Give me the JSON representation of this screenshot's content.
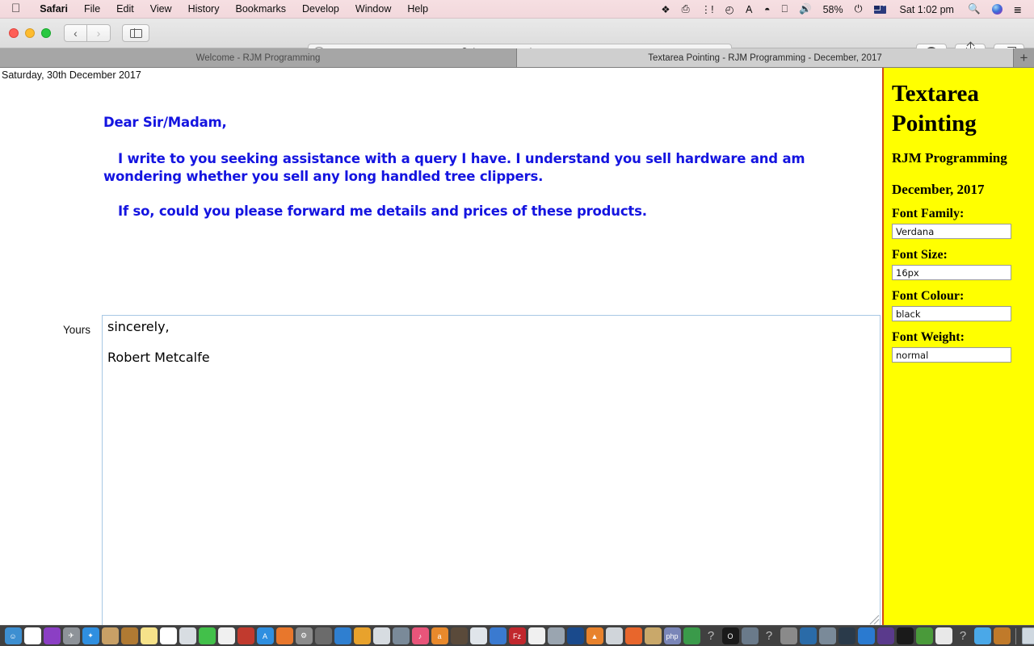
{
  "menubar": {
    "apple_icon": "apple-logo-icon",
    "items": [
      {
        "label": "Safari",
        "bold": true
      },
      {
        "label": "File",
        "bold": false
      },
      {
        "label": "Edit",
        "bold": false
      },
      {
        "label": "View",
        "bold": false
      },
      {
        "label": "History",
        "bold": false
      },
      {
        "label": "Bookmarks",
        "bold": false
      },
      {
        "label": "Develop",
        "bold": false
      },
      {
        "label": "Window",
        "bold": false
      },
      {
        "label": "Help",
        "bold": false
      }
    ],
    "status": {
      "battery_percent": "58%",
      "clock": "Sat 1:02 pm",
      "icons": [
        "dropbox-icon",
        "airplay-audio-icon",
        "wifi-signal-dots-icon",
        "time-machine-icon",
        "bluetooth-icon",
        "wifi-icon",
        "screen-mirroring-icon",
        "volume-icon",
        "battery-charging-icon",
        "australia-flag-icon",
        "spotlight-search-icon",
        "siri-icon",
        "notification-center-icon"
      ]
    }
  },
  "toolbar": {
    "back_label": "‹",
    "forward_label": "›",
    "url": "rjmprogramming.com.au",
    "reload_label": "↻",
    "plus_label": "+",
    "buttons": [
      "downloads-button",
      "share-button",
      "tab-overview-button"
    ]
  },
  "tabs": {
    "inactive_label": "Welcome - RJM Programming",
    "active_label": "Textarea Pointing - RJM Programming - December, 2017",
    "new_tab_label": "+"
  },
  "page": {
    "datestamp": "Saturday, 30th December 2017",
    "greeting": "Dear Sir/Madam,",
    "paragraph1": "I write to you seeking assistance with a query I have.  I understand you sell hardware and am wondering whether you sell any long handled tree clippers.",
    "paragraph2": "If so, could you please forward me details and prices of these products.",
    "letter_colour": "#1414e0",
    "yours_label": "Yours",
    "textarea_value": "sincerely,\n\nRobert Metcalfe"
  },
  "sidebar": {
    "title_line1": "Textarea",
    "title_line2": "Pointing",
    "subtitle": "RJM Programming",
    "date": "December, 2017",
    "background_colour": "#ffff00",
    "fields": [
      {
        "label": "Font Family:",
        "value": "Verdana",
        "name": "font-family-input"
      },
      {
        "label": "Font Size:",
        "value": "16px",
        "name": "font-size-input"
      },
      {
        "label": "Font Colour:",
        "value": "black",
        "name": "font-colour-input"
      },
      {
        "label": "Font Weight:",
        "value": "normal",
        "name": "font-weight-input"
      }
    ]
  },
  "dock": {
    "icons": [
      {
        "name": "finder-icon",
        "colour": "#3d8fd1",
        "glyph": "☺",
        "running": true
      },
      {
        "name": "document-icon",
        "colour": "#ffffff",
        "glyph": "",
        "running": true
      },
      {
        "name": "siri-icon",
        "colour": "#8b3fc4",
        "glyph": "",
        "running": false
      },
      {
        "name": "launchpad-icon",
        "colour": "#8e9399",
        "glyph": "✈",
        "running": false
      },
      {
        "name": "safari-icon",
        "colour": "#2f8fe0",
        "glyph": "✦",
        "running": true
      },
      {
        "name": "contacts-icon",
        "colour": "#c8a066",
        "glyph": "",
        "running": false
      },
      {
        "name": "notes-book-icon",
        "colour": "#b07a33",
        "glyph": "",
        "running": false
      },
      {
        "name": "notes-icon",
        "colour": "#f6e28a",
        "glyph": "",
        "running": false
      },
      {
        "name": "calendar-icon",
        "colour": "#ffffff",
        "glyph": "30",
        "running": false
      },
      {
        "name": "preview-icon",
        "colour": "#d8dde2",
        "glyph": "",
        "running": false
      },
      {
        "name": "messages-icon",
        "colour": "#42c04a",
        "glyph": "",
        "running": false
      },
      {
        "name": "photos-icon",
        "colour": "#f0f0f0",
        "glyph": "",
        "running": false
      },
      {
        "name": "qr-app-icon",
        "colour": "#c13a2e",
        "glyph": "",
        "running": false
      },
      {
        "name": "app-store-icon",
        "colour": "#2f8fe0",
        "glyph": "A",
        "running": false
      },
      {
        "name": "ibooks-icon",
        "colour": "#e8772c",
        "glyph": "",
        "running": false
      },
      {
        "name": "system-preferences-icon",
        "colour": "#8c8c8c",
        "glyph": "⚙",
        "running": true
      },
      {
        "name": "airport-utility-icon",
        "colour": "#6b6b6b",
        "glyph": "",
        "running": false
      },
      {
        "name": "bin-blue-icon",
        "colour": "#2f7fd0",
        "glyph": "",
        "running": false
      },
      {
        "name": "wolfram-icon",
        "colour": "#e8a22c",
        "glyph": "",
        "running": true
      },
      {
        "name": "pen-app-icon",
        "colour": "#d7dce1",
        "glyph": "",
        "running": true
      },
      {
        "name": "image-capture-icon",
        "colour": "#7a8a99",
        "glyph": "",
        "running": true
      },
      {
        "name": "itunes-icon",
        "colour": "#e8557a",
        "glyph": "♪",
        "running": false
      },
      {
        "name": "amazon-icon",
        "colour": "#e8892c",
        "glyph": "a",
        "running": false
      },
      {
        "name": "gimp-icon",
        "colour": "#5a4a3a",
        "glyph": "",
        "running": false
      },
      {
        "name": "maps-icon",
        "colour": "#e0e5ea",
        "glyph": "",
        "running": false
      },
      {
        "name": "remote-desktop-icon",
        "colour": "#3a7ad0",
        "glyph": "",
        "running": false
      },
      {
        "name": "filezilla-icon",
        "colour": "#c1272d",
        "glyph": "Fz",
        "running": false
      },
      {
        "name": "chrome-icon",
        "colour": "#f0f0f0",
        "glyph": "",
        "running": false
      },
      {
        "name": "ie-icon",
        "colour": "#9aa5b0",
        "glyph": "",
        "running": false
      },
      {
        "name": "opera-blue-icon",
        "colour": "#1a4a8c",
        "glyph": "",
        "running": false
      },
      {
        "name": "vlc-icon",
        "colour": "#e8822c",
        "glyph": "▲",
        "running": false
      },
      {
        "name": "cube-icon",
        "colour": "#d0d5da",
        "glyph": "",
        "running": false
      },
      {
        "name": "firefox-icon",
        "colour": "#e8662c",
        "glyph": "",
        "running": true
      },
      {
        "name": "text-app-icon",
        "colour": "#c9a86a",
        "glyph": "",
        "running": false
      },
      {
        "name": "php-icon",
        "colour": "#7a86b8",
        "glyph": "php",
        "running": true
      },
      {
        "name": "android-studio-icon",
        "colour": "#3a9a4a",
        "glyph": "",
        "running": false
      },
      {
        "name": "unknown-app-1-icon",
        "colour": "transparent",
        "glyph": "?",
        "running": false
      },
      {
        "name": "opera-icon",
        "colour": "#1a1a1a",
        "glyph": "O",
        "running": true
      },
      {
        "name": "virtualbox-icon",
        "colour": "#6a7a8a",
        "glyph": "",
        "running": false
      },
      {
        "name": "unknown-app-2-icon",
        "colour": "transparent",
        "glyph": "?",
        "running": false
      },
      {
        "name": "keys-icon",
        "colour": "#8a8a8a",
        "glyph": "",
        "running": false
      },
      {
        "name": "vscode-icon",
        "colour": "#2a6ba8",
        "glyph": "",
        "running": false
      },
      {
        "name": "screenshot-app-icon",
        "colour": "#7a8a99",
        "glyph": "",
        "running": false
      },
      {
        "name": "globe-grid-icon",
        "colour": "#2a3a4a",
        "glyph": "",
        "running": false
      },
      {
        "name": "swift-icon",
        "colour": "#2a7ad0",
        "glyph": "",
        "running": false
      },
      {
        "name": "github-icon",
        "colour": "#5a3a8c",
        "glyph": "",
        "running": false
      },
      {
        "name": "terminal-icon",
        "colour": "#1a1a1a",
        "glyph": "",
        "running": true
      },
      {
        "name": "nodejs-dots-icon",
        "colour": "#4a9a3a",
        "glyph": "",
        "running": true
      },
      {
        "name": "inkdrop-icon",
        "colour": "#e8e8e8",
        "glyph": "",
        "running": false
      },
      {
        "name": "unknown-app-3-icon",
        "colour": "transparent",
        "glyph": "?",
        "running": false
      },
      {
        "name": "folder-icon",
        "colour": "#4aa8e8",
        "glyph": "",
        "running": false
      },
      {
        "name": "violin-icon",
        "colour": "#c07a2a",
        "glyph": "",
        "running": false
      }
    ],
    "minimized": [
      {
        "name": "minimized-window-1",
        "colour": "#cfd8e0"
      },
      {
        "name": "minimized-window-2",
        "colour": "#cfd8e0"
      },
      {
        "name": "minimized-window-3",
        "colour": "#d6dde4"
      },
      {
        "name": "minimized-window-4",
        "colour": "#cfd8e0"
      },
      {
        "name": "minimized-window-5",
        "colour": "#e6eaee"
      },
      {
        "name": "minimized-window-6",
        "colour": "#cfd8e0"
      },
      {
        "name": "minimized-window-7",
        "colour": "#dfe4e9"
      }
    ],
    "trash_name": "trash-icon"
  }
}
